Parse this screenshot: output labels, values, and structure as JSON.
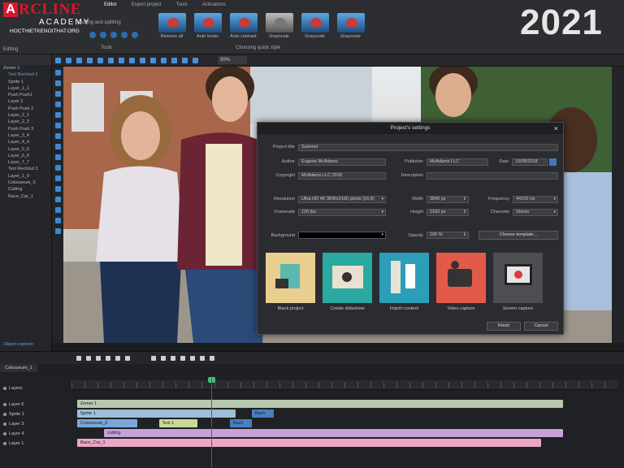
{
  "menu": {
    "items": [
      "Editor",
      "Export project",
      "Tools",
      "Activations"
    ],
    "active": 0
  },
  "ribbon": {
    "find_label": "Cutting and splitting",
    "tools_label": "Tools",
    "editing_label": "Editing",
    "quick_styles": [
      {
        "label": "Remove all",
        "variant": "color"
      },
      {
        "label": "Auto levels",
        "variant": "color"
      },
      {
        "label": "Auto contrast",
        "variant": "color"
      },
      {
        "label": "Grayscale",
        "variant": "gray"
      },
      {
        "label": "Grayscale",
        "variant": "color"
      },
      {
        "label": "Grayscale",
        "variant": "color"
      }
    ],
    "quick_styles_title": "Choosing quick style"
  },
  "watermark": {
    "logo_letter": "A",
    "logo_name": "RCLINE",
    "academy": "ACADEMY",
    "site": "HOCTHIETKENOITHAT.ORG",
    "year": "2021"
  },
  "toolbar": {
    "zoom": "50%"
  },
  "tree": {
    "rows": [
      "Zemer 1",
      "Text Rechtsd 2",
      "Sprite 1",
      "Layer_1_1",
      "Push Push1",
      "Layer 2",
      "Push Push 2",
      "Layer_2_2",
      "Layer_2_3",
      "Push Push 3",
      "Layer_3_4",
      "Layer_4_4",
      "Layer_5_5",
      "Layer_6_6",
      "Layer_7_7",
      "Text Rechtsd 3",
      "Layer_1_9",
      "Colosseum_0",
      "Cutting",
      "Race_Car_1"
    ],
    "selected": [
      1
    ],
    "footer": "Object explorer"
  },
  "dialog": {
    "title": "Project's settings",
    "project_title_label": "Project title",
    "project_title": "Summer",
    "author_label": "Author",
    "author": "Eugene McAdams",
    "publisher_label": "Publisher",
    "publisher": "McAdams LLC",
    "date_label": "Date",
    "date": "10/05/2018",
    "copyright_label": "Copyright",
    "copyright": "McAdams LLC 2018",
    "description_label": "Description",
    "description": "",
    "resolution_label": "Resolution",
    "resolution": "Ultra HD 4K 3840x2160 pixels (16:9)",
    "width_label": "Width",
    "width": "3840 px",
    "frequency_label": "Frequency",
    "frequency": "44100 Hz",
    "framerate_label": "Framerate",
    "framerate": "120 fps",
    "height_label": "Height",
    "height": "2160 px",
    "channels_label": "Channels",
    "channels": "Stereo",
    "background_label": "Background",
    "opacity_label": "Opacity",
    "opacity": "100 %",
    "choose_template": "Choose template...",
    "tiles": [
      "Blank project",
      "Create slideshow",
      "Import content",
      "Video capture",
      "Screen capture"
    ],
    "finish": "Finish",
    "cancel": "Cancel"
  },
  "timeline": {
    "tab": "Colosseum_1",
    "root_label": "Layers",
    "layers": [
      {
        "name": "Layer 6",
        "clips": [
          {
            "label": "Zemer 1",
            "start": 0.01,
            "end": 0.9,
            "color": "#b8c8b0"
          }
        ]
      },
      {
        "name": "Sprite 1",
        "clips": [
          {
            "label": "Sprite 1",
            "start": 0.01,
            "end": 0.3,
            "color": "#9bbfd9"
          },
          {
            "label": "Bach",
            "start": 0.33,
            "end": 0.37,
            "color": "#4a7fc0"
          }
        ]
      },
      {
        "name": "Layer 3",
        "clips": [
          {
            "label": "Colosseum_0",
            "start": 0.01,
            "end": 0.12,
            "color": "#7aa7d8"
          },
          {
            "label": "Text 1",
            "start": 0.16,
            "end": 0.23,
            "color": "#c9d99c"
          },
          {
            "label": "Bach",
            "start": 0.29,
            "end": 0.33,
            "color": "#4a7fc0"
          }
        ]
      },
      {
        "name": "Layer 4",
        "clips": [
          {
            "label": "cutting",
            "start": 0.06,
            "end": 0.9,
            "color": "#c6a2d8"
          }
        ]
      },
      {
        "name": "Layer 1",
        "clips": [
          {
            "label": "Race_Car_1",
            "start": 0.01,
            "end": 0.86,
            "color": "#e9a9c6"
          }
        ]
      }
    ]
  }
}
